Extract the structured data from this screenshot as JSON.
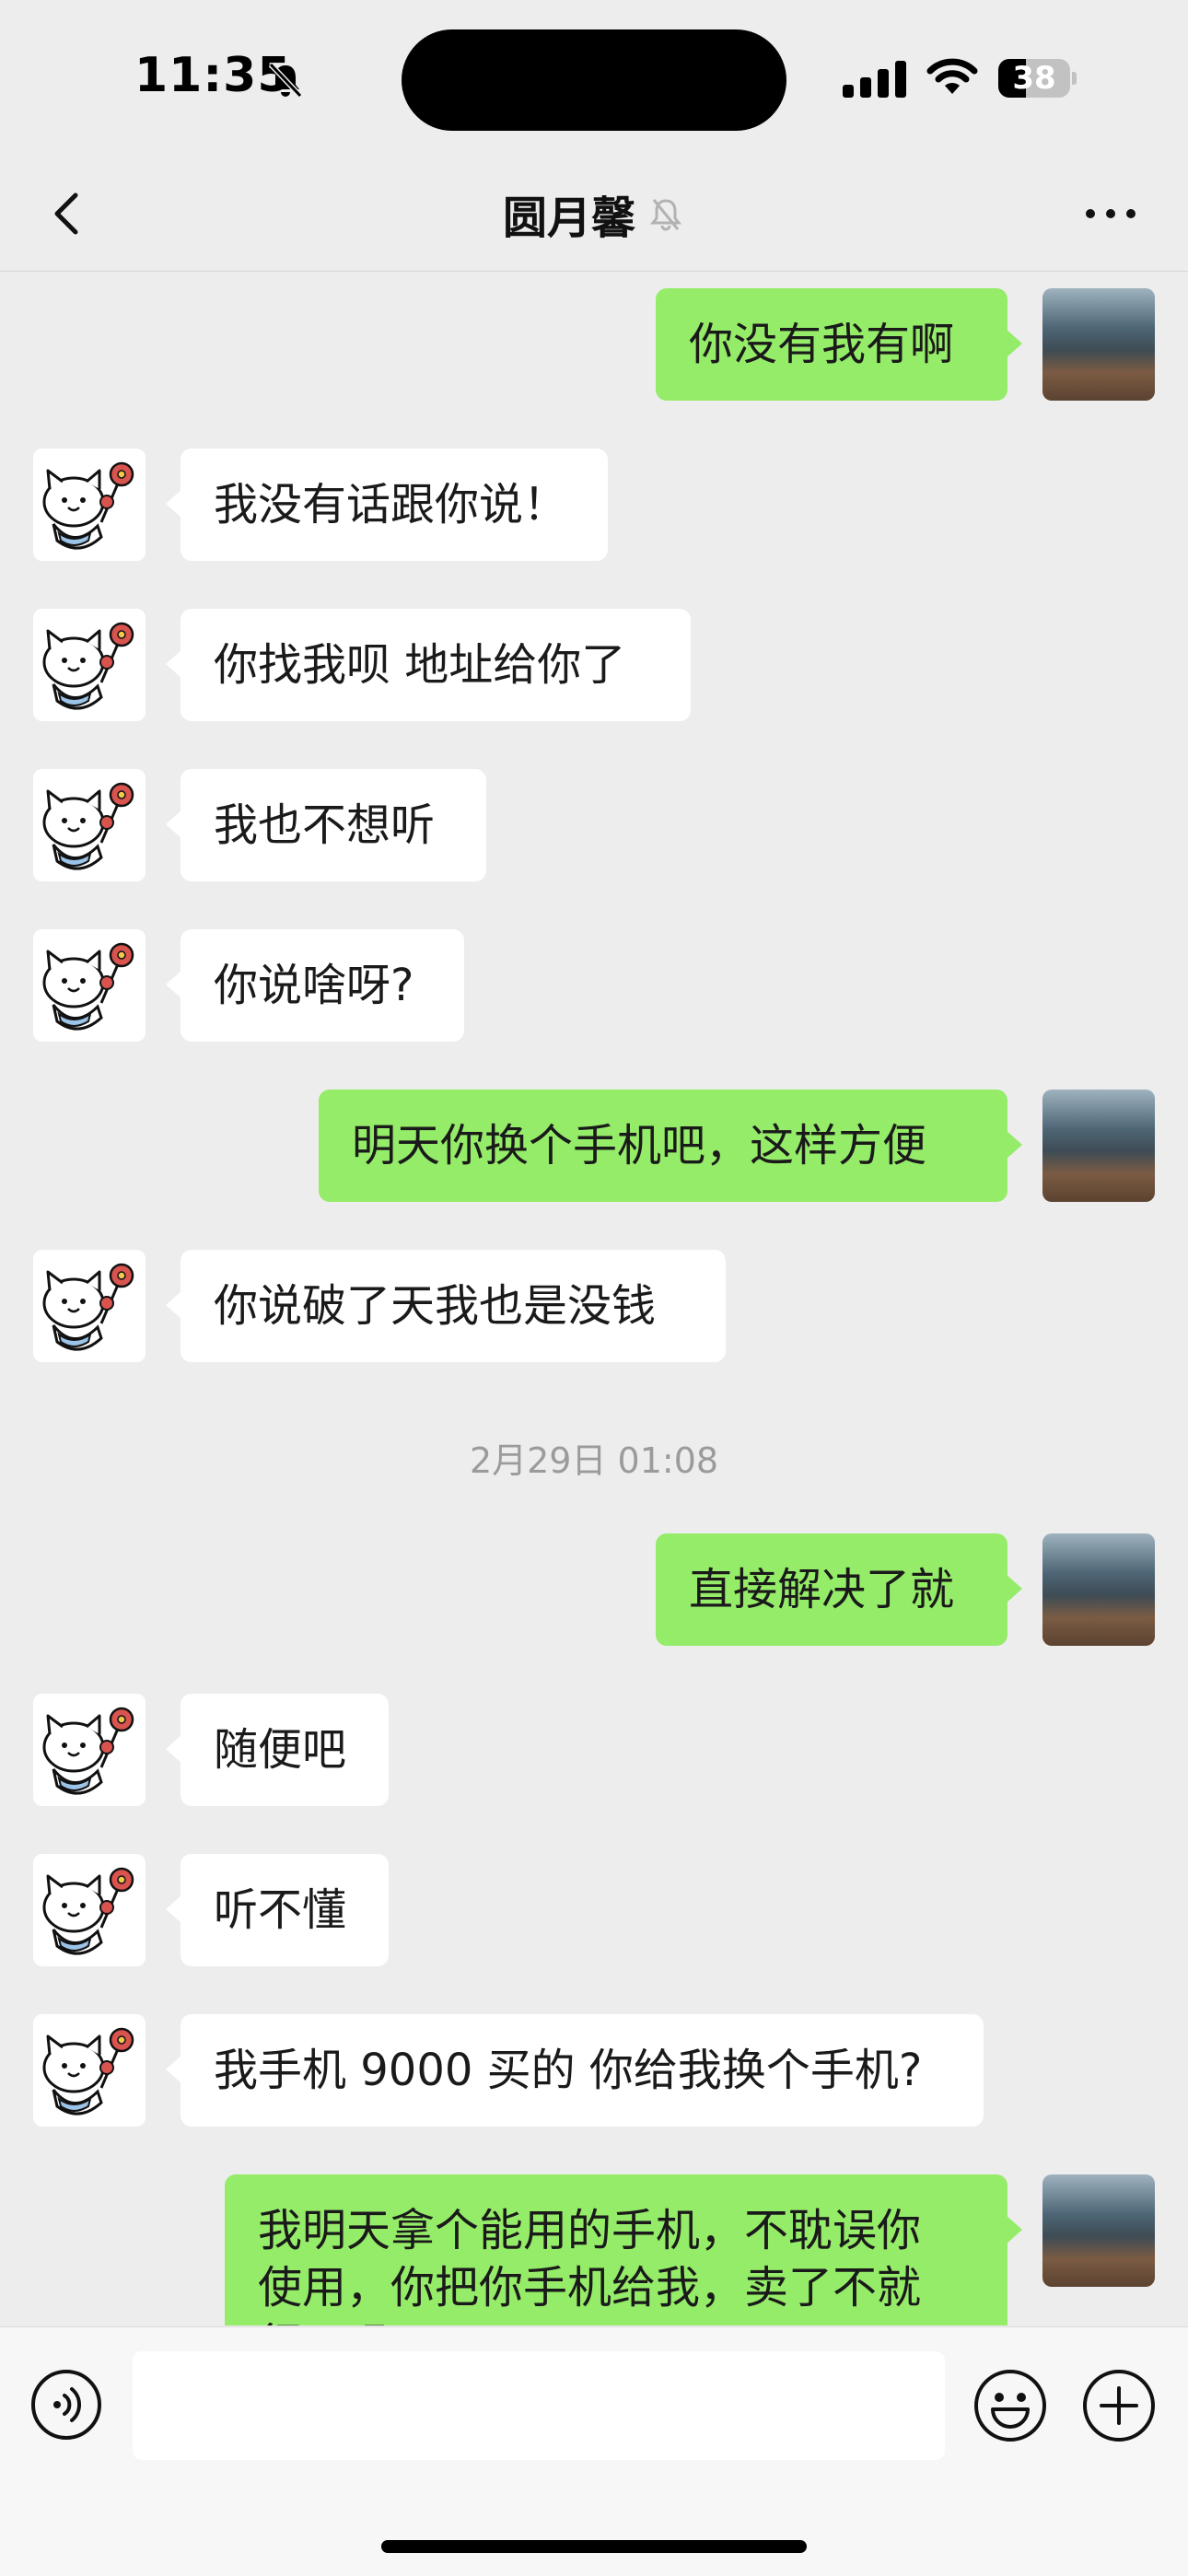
{
  "status_bar": {
    "time": "11:35",
    "battery_level": "38",
    "battery_fraction": 0.38
  },
  "header": {
    "title": "圆月馨"
  },
  "messages": [
    {
      "side": "out",
      "text": "你没有我有啊"
    },
    {
      "side": "in",
      "text": "我没有话跟你说！"
    },
    {
      "side": "in",
      "text": "你找我呗 地址给你了"
    },
    {
      "side": "in",
      "text": "我也不想听"
    },
    {
      "side": "in",
      "text": "你说啥呀?"
    },
    {
      "side": "out",
      "text": "明天你换个手机吧，这样方便"
    },
    {
      "side": "in",
      "text": "你说破了天我也是没钱"
    },
    {
      "side": "time",
      "text": "2月29日 01:08"
    },
    {
      "side": "out",
      "text": "直接解决了就"
    },
    {
      "side": "in",
      "text": "随便吧"
    },
    {
      "side": "in",
      "text": "听不懂"
    },
    {
      "side": "in",
      "text": "我手机 9000 买的 你给我换个手机?"
    },
    {
      "side": "out",
      "text": "我明天拿个能用的手机，不耽误你\n使用，你把你手机给我，卖了不就\n行了吗"
    }
  ],
  "input": {
    "value": "",
    "placeholder": ""
  },
  "icons": {
    "back": "chevron-left-icon",
    "mute": "bell-off-icon",
    "more": "ellipsis-icon",
    "voice": "voice-icon",
    "emoji": "emoji-icon",
    "plus": "plus-icon"
  },
  "colors": {
    "background": "#ededed",
    "outgoing_bubble": "#95ec69",
    "incoming_bubble": "#ffffff",
    "timestamp": "#9b9b9b"
  }
}
